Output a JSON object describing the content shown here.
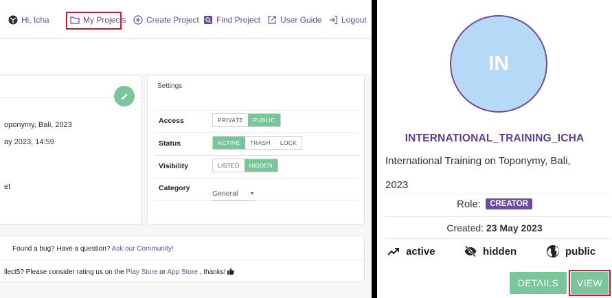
{
  "nav": {
    "greeting": "Hi, Icha",
    "my_projects": "My Projects",
    "create_project": "Create Project",
    "find_project": "Find Project",
    "user_guide": "User Guide",
    "logout": "Logout"
  },
  "project_info": {
    "description_fragment": "oponymy, Bali, 2023",
    "created_fragment": "ay 2023, 14:59",
    "other_fragment": "et"
  },
  "settings": {
    "title": "Settings",
    "access": {
      "label": "Access",
      "options": [
        "PRIVATE",
        "PUBLIC"
      ],
      "selected": "PUBLIC"
    },
    "status": {
      "label": "Status",
      "options": [
        "ACTIVE",
        "TRASH",
        "LOCK"
      ],
      "selected": "ACTIVE"
    },
    "visibility": {
      "label": "Visibility",
      "options": [
        "LISTED",
        "HIDDEN"
      ],
      "selected": "HIDDEN"
    },
    "category": {
      "label": "Category",
      "value": "General"
    }
  },
  "footer": {
    "bug_text": "Found a bug? Have a question?",
    "bug_link": "Ask our Community!",
    "rating_prefix": "llect5? Please consider rating us on the",
    "play_store": "Play Store",
    "or": "or",
    "app_store": "App Store",
    "rating_suffix": ", thanks!"
  },
  "project_card": {
    "initials": "IN",
    "name": "INTERNATIONAL_TRAINING_ICHA",
    "description_line1": "International Training on Toponymy, Bali,",
    "description_line2": "2023",
    "role_label": "Role:",
    "role": "CREATOR",
    "created_label": "Created:",
    "created_date": "23 May 2023",
    "status_active": "active",
    "status_hidden": "hidden",
    "status_public": "public",
    "details_button": "DETAILS",
    "view_button": "VIEW"
  },
  "colors": {
    "accent_purple": "#6d4c9e",
    "toggle_green": "#7bc59a",
    "highlight_red": "#e4102b",
    "avatar_blue": "#b7d9f8"
  }
}
